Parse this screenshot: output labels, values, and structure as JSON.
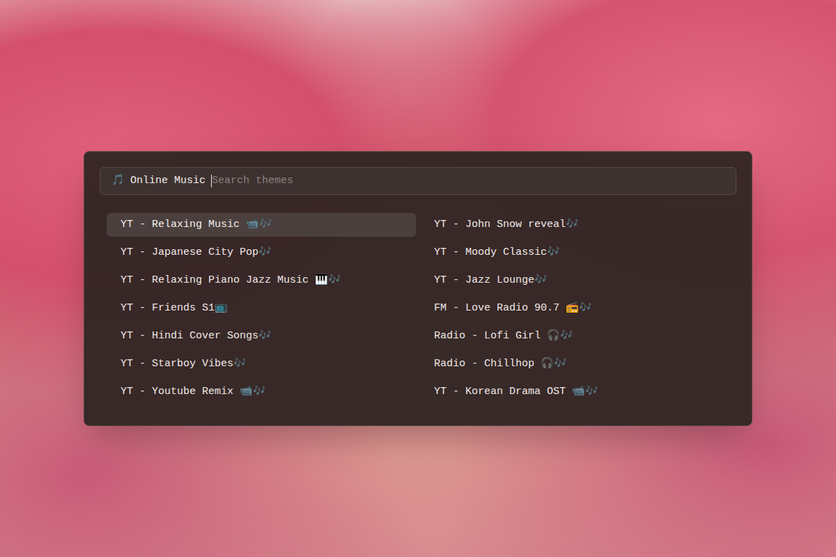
{
  "search": {
    "icon": "🎵",
    "label": "Online Music",
    "placeholder": "Search themes"
  },
  "items": [
    {
      "label": "YT - Relaxing Music 📹🎶",
      "selected": true
    },
    {
      "label": "YT - Japanese City Pop🎶",
      "selected": false
    },
    {
      "label": "YT - Relaxing Piano Jazz Music 🎹🎶",
      "selected": false
    },
    {
      "label": "YT - Friends S1📺",
      "selected": false
    },
    {
      "label": "YT - Hindi Cover Songs🎶",
      "selected": false
    },
    {
      "label": "YT - Starboy Vibes🎶",
      "selected": false
    },
    {
      "label": "YT - Youtube Remix 📹🎶",
      "selected": false
    },
    {
      "label": "YT - John Snow reveal🎶",
      "selected": false
    },
    {
      "label": "YT - Moody Classic🎶",
      "selected": false
    },
    {
      "label": "YT - Jazz Lounge🎶",
      "selected": false
    },
    {
      "label": "FM - Love Radio 90.7 📻🎶",
      "selected": false
    },
    {
      "label": "Radio - Lofi Girl 🎧🎶",
      "selected": false
    },
    {
      "label": "Radio - Chillhop 🎧🎶",
      "selected": false
    },
    {
      "label": "YT - Korean Drama OST 📹🎶",
      "selected": false
    }
  ]
}
